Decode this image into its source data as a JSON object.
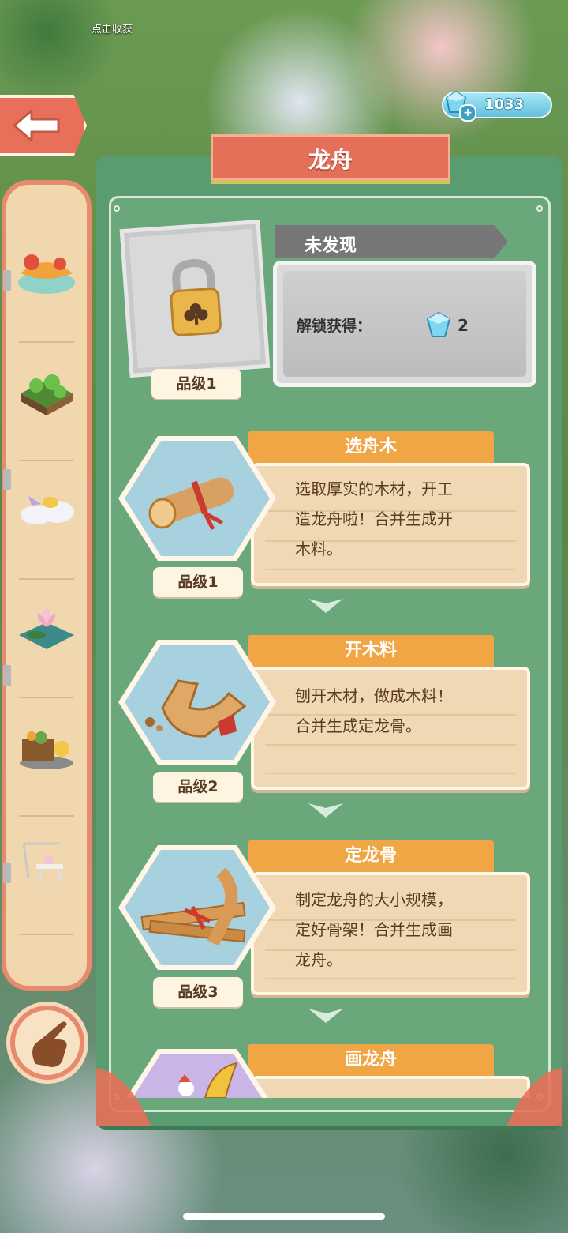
{
  "hud": {
    "harvest_text": "点击收获",
    "gem_count": "1033",
    "plus_label": "+"
  },
  "panel": {
    "title": "龙舟"
  },
  "locked_item": {
    "status": "未发现",
    "unlock_label": "解锁获得：",
    "unlock_reward": "2",
    "grade": "品级1"
  },
  "items": [
    {
      "name": "选舟木",
      "grade": "品级1",
      "desc_lines": [
        "选取厚实的木材，开工",
        "造龙舟啦！合并生成开",
        "木料。"
      ]
    },
    {
      "name": "开木料",
      "grade": "品级2",
      "desc_lines": [
        "刨开木材，做成木料！",
        "合并生成定龙骨。",
        ""
      ]
    },
    {
      "name": "定龙骨",
      "grade": "品级3",
      "desc_lines": [
        "制定龙舟的大小规模，",
        "定好骨架！合并生成画",
        "龙舟。"
      ]
    },
    {
      "name": "画龙舟",
      "grade": "",
      "desc_lines": []
    }
  ],
  "colors": {
    "panel_green": "#5a9b72",
    "banner_red": "#e5705a",
    "card_title_orange": "#f1a645",
    "card_bg": "#f0d8b5",
    "hex_blue": "#a8d1e0"
  },
  "sidebar": {
    "items": [
      "dragon-boat-collection-icon",
      "clover-garden-icon",
      "cloud-bird-icon",
      "lotus-pond-icon",
      "basket-cart-icon",
      "tea-table-icon"
    ]
  }
}
